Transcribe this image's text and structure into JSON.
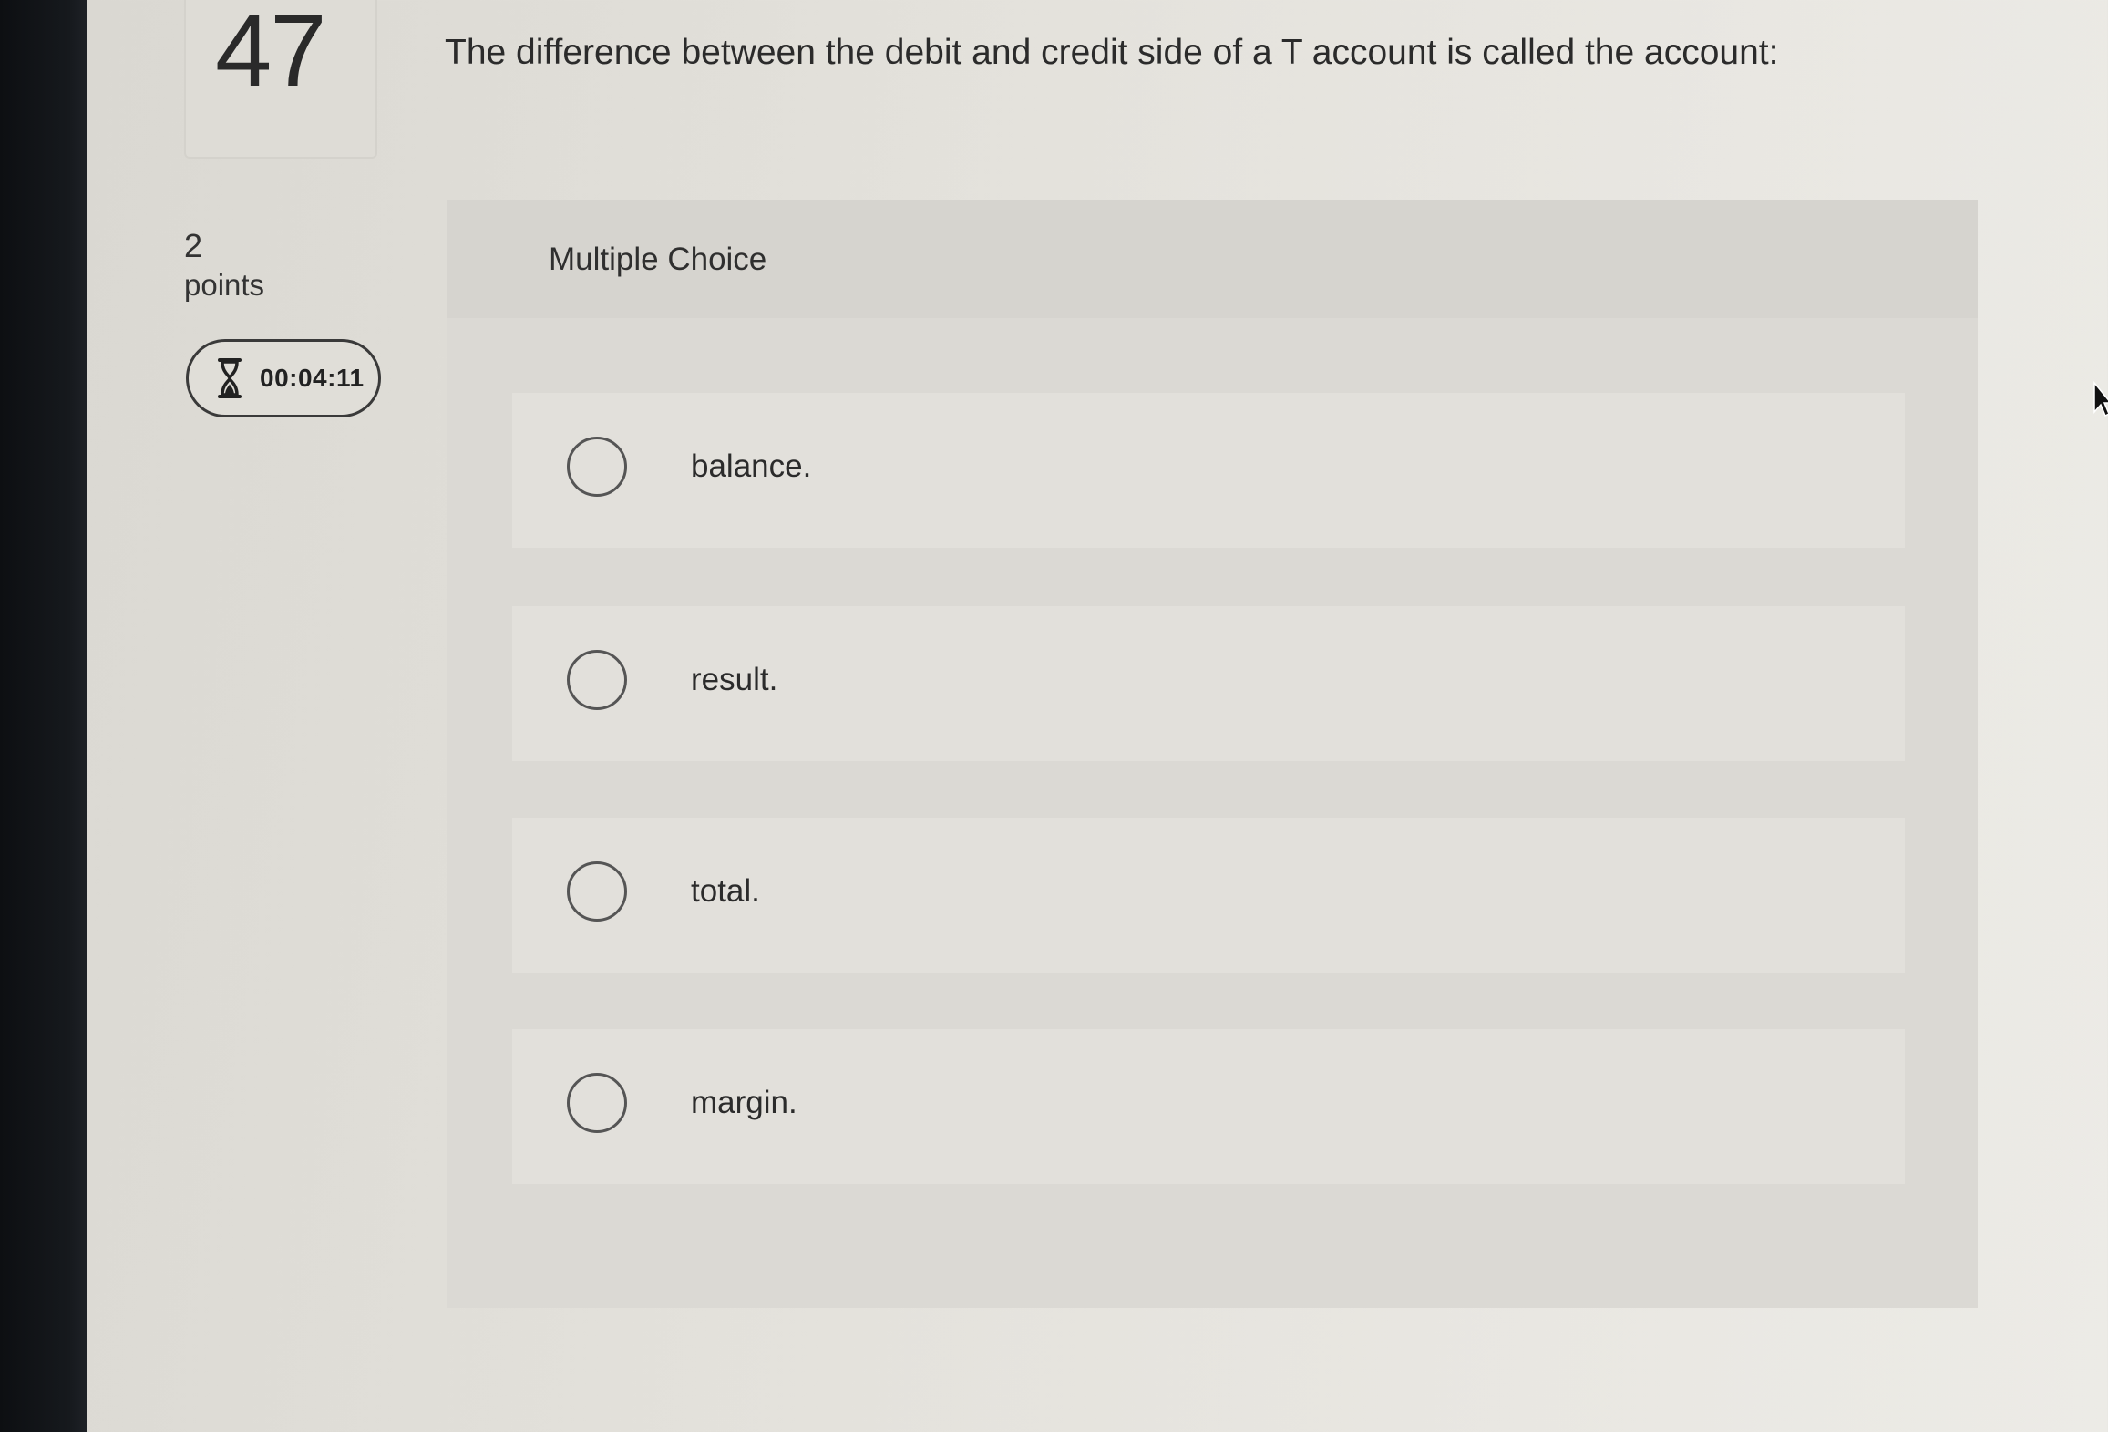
{
  "question": {
    "number": "47",
    "text": "The difference between the debit and credit side of a T account is called the account:"
  },
  "score": {
    "points_value": "2",
    "points_label": "points"
  },
  "timer": {
    "icon": "hourglass-icon",
    "value": "00:04:11"
  },
  "multiple_choice": {
    "header": "Multiple Choice",
    "options": [
      {
        "label": "balance.",
        "selected": false
      },
      {
        "label": "result.",
        "selected": false
      },
      {
        "label": "total.",
        "selected": false
      },
      {
        "label": "margin.",
        "selected": false
      }
    ]
  },
  "colors": {
    "text": "#2b2b2b",
    "bezel": "#111417",
    "panel": "#dbd9d4",
    "option_bg": "#e2e0db"
  }
}
